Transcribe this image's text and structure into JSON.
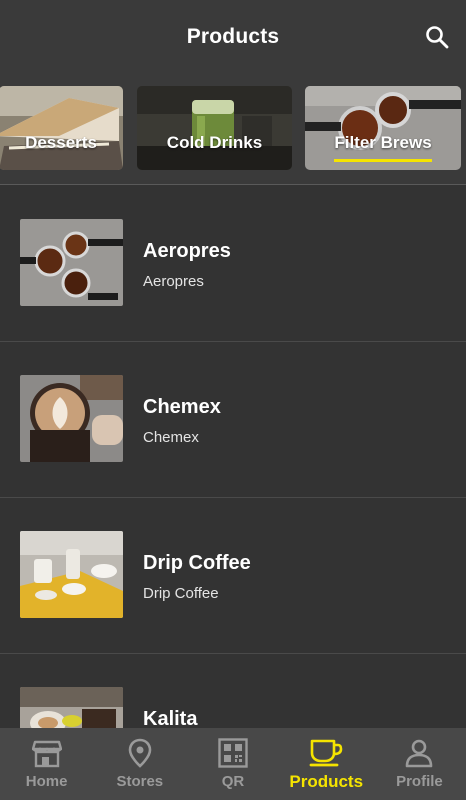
{
  "header": {
    "title": "Products"
  },
  "categories": [
    {
      "label": "Desserts",
      "selected": false
    },
    {
      "label": "Cold Drinks",
      "selected": false
    },
    {
      "label": "Filter Brews",
      "selected": true
    }
  ],
  "products": [
    {
      "name": "Aeropres",
      "subtitle": "Aeropres"
    },
    {
      "name": "Chemex",
      "subtitle": "Chemex"
    },
    {
      "name": "Drip Coffee",
      "subtitle": "Drip Coffee"
    },
    {
      "name": "Kalita",
      "subtitle": ""
    }
  ],
  "nav": {
    "items": [
      {
        "label": "Home",
        "icon": "store-icon"
      },
      {
        "label": "Stores",
        "icon": "location-pin-icon"
      },
      {
        "label": "QR",
        "icon": "qr-code-icon"
      },
      {
        "label": "Products",
        "icon": "coffee-cup-icon"
      },
      {
        "label": "Profile",
        "icon": "person-icon"
      }
    ],
    "active": "Products"
  },
  "colors": {
    "accent": "#f5e400",
    "background": "#333333",
    "header": "#3a3a3a",
    "nav": "#484848",
    "inactive": "#9a9a9a"
  }
}
